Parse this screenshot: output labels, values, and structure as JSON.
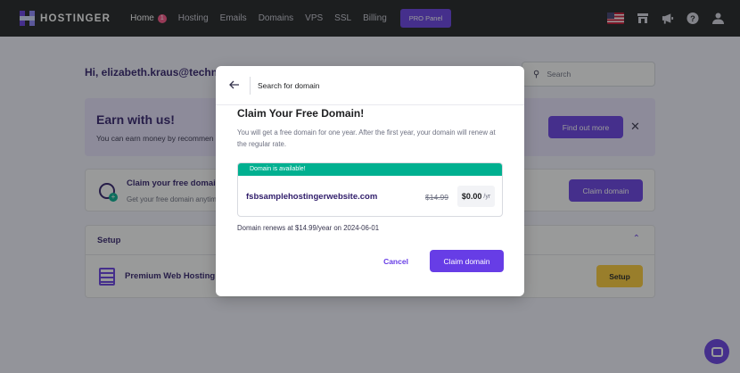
{
  "nav": {
    "logo_text": "HOSTINGER",
    "items": [
      {
        "label": "Home",
        "badge": "1",
        "active": true
      },
      {
        "label": "Hosting"
      },
      {
        "label": "Emails"
      },
      {
        "label": "Domains"
      },
      {
        "label": "VPS"
      },
      {
        "label": "SSL"
      },
      {
        "label": "Billing"
      }
    ],
    "pro_panel_label": "PRO Panel",
    "icons": [
      "us-flag-icon",
      "store-icon",
      "megaphone-icon",
      "help-icon",
      "user-icon"
    ]
  },
  "background": {
    "greeting": "Hi, elizabeth.kraus@techn",
    "search_placeholder": "Search",
    "earn": {
      "title": "Earn with us!",
      "text": "You can earn money by recommen",
      "button": "Find out more"
    },
    "claim": {
      "title": "Claim your free domain",
      "subtitle": "Get your free domain anytim",
      "button": "Claim domain"
    },
    "setup": {
      "title": "Setup",
      "item": "Premium Web Hosting",
      "button": "Setup"
    }
  },
  "modal": {
    "header_title": "Search for domain",
    "title": "Claim Your Free Domain!",
    "description": "You will get a free domain for one year. After the first year, your domain will renew at the regular rate.",
    "availability": "Domain is available!",
    "domain": "fsbsamplehostingerwebsite.com",
    "old_price": "$14.99",
    "new_price": "$0.00",
    "per_year": "/yr",
    "renews": "Domain renews at $14.99/year on 2024-06-01",
    "cancel_label": "Cancel",
    "claim_label": "Claim domain"
  },
  "colors": {
    "brand": "#673de6",
    "nav_bg": "#1d1e20",
    "success": "#00b090",
    "warning": "#ffcd35"
  }
}
